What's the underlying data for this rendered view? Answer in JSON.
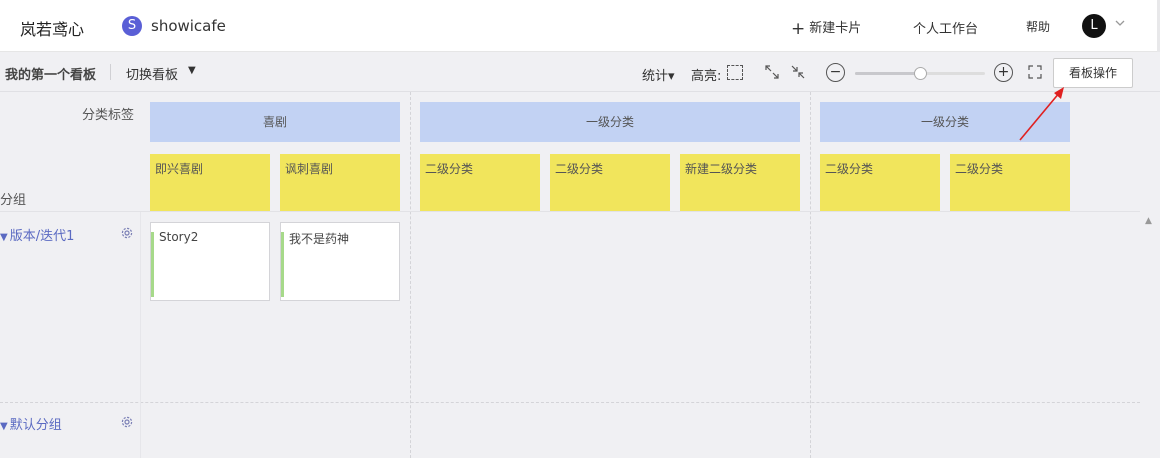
{
  "header": {
    "brand": "岚若鸢心",
    "project_icon_letter": "S",
    "project_name": "showicafe",
    "new_card_label": "新建卡片",
    "workbench_label": "个人工作台",
    "help_label": "帮助",
    "avatar_letter": "L"
  },
  "toolbar": {
    "board_name": "我的第一个看板",
    "switch_board_label": "切换看板",
    "stats_label": "统计▾",
    "highlight_label": "高亮:",
    "zoom_level": 0.5,
    "board_ops_label": "看板操作"
  },
  "board": {
    "category_label": "分类标签",
    "group_label": "分组",
    "level1": [
      {
        "label": "喜剧"
      },
      {
        "label": "一级分类"
      },
      {
        "label": "一级分类"
      }
    ],
    "level2": [
      {
        "label": "即兴喜剧"
      },
      {
        "label": "讽刺喜剧"
      },
      {
        "label": "二级分类"
      },
      {
        "label": "二级分类"
      },
      {
        "label": "新建二级分类"
      },
      {
        "label": "二级分类"
      },
      {
        "label": "二级分类"
      }
    ],
    "lanes": [
      {
        "label": "版本/迭代1"
      },
      {
        "label": "默认分组"
      }
    ],
    "cards": [
      {
        "title": "Story2"
      },
      {
        "title": "我不是药神"
      }
    ]
  },
  "colors": {
    "level1_bg": "#c2d2f3",
    "level2_bg": "#f1e55c",
    "lane_title": "#5b6ac2",
    "card_stripe": "#a6d98a",
    "annotation_arrow": "#e02020"
  }
}
